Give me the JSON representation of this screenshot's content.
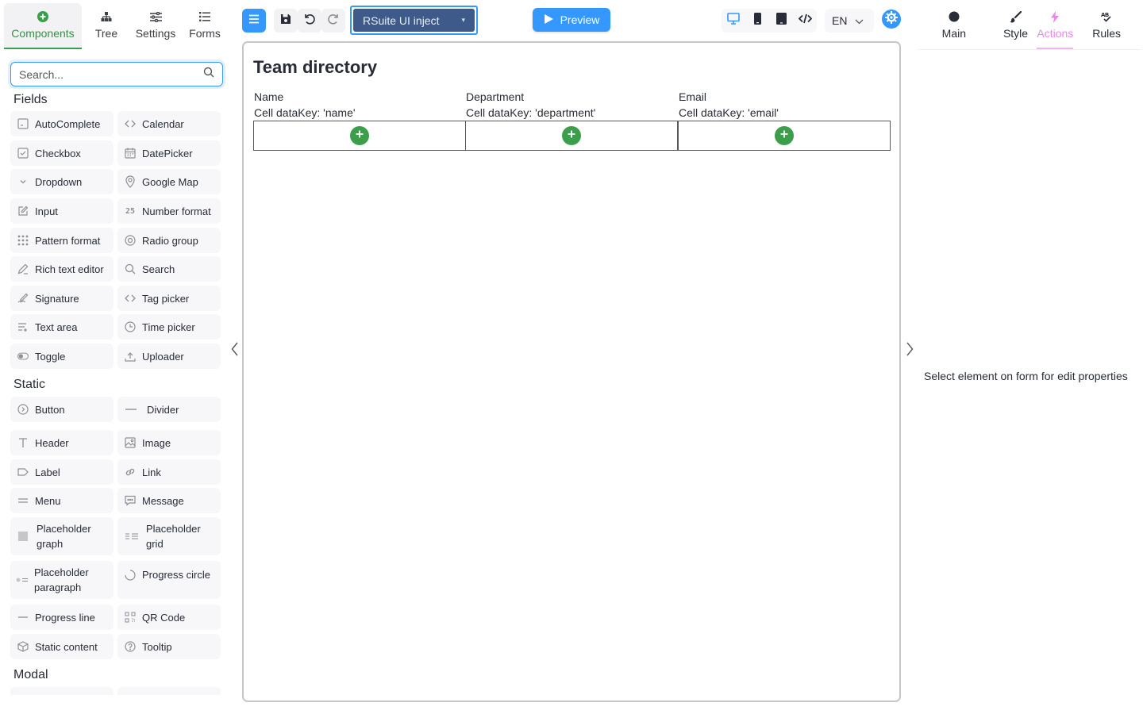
{
  "left_tabs": [
    {
      "label": "Components",
      "icon": "plus-circle-icon",
      "active": true
    },
    {
      "label": "Tree",
      "icon": "tree-icon"
    },
    {
      "label": "Settings",
      "icon": "sliders-icon"
    },
    {
      "label": "Forms",
      "icon": "list-icon"
    }
  ],
  "search": {
    "placeholder": "Search..."
  },
  "sections": {
    "fields": "Fields",
    "static": "Static",
    "modal": "Modal"
  },
  "fields": [
    {
      "label": "AutoComplete",
      "icon": "autocomplete-icon"
    },
    {
      "label": "Calendar",
      "icon": "code-brackets-icon"
    },
    {
      "label": "Checkbox",
      "icon": "checkbox-icon"
    },
    {
      "label": "DatePicker",
      "icon": "calendar-icon"
    },
    {
      "label": "Dropdown",
      "icon": "chevron-down-icon"
    },
    {
      "label": "Google Map",
      "icon": "map-pin-icon"
    },
    {
      "label": "Input",
      "icon": "edit-icon"
    },
    {
      "label": "Number format",
      "icon": "number-icon"
    },
    {
      "label": "Pattern format",
      "icon": "dots-grid-icon"
    },
    {
      "label": "Radio group",
      "icon": "radio-icon"
    },
    {
      "label": "Rich text editor",
      "icon": "pencil-icon"
    },
    {
      "label": "Search",
      "icon": "search-icon"
    },
    {
      "label": "Signature",
      "icon": "signature-icon"
    },
    {
      "label": "Tag picker",
      "icon": "code-brackets-icon"
    },
    {
      "label": "Text area",
      "icon": "text-lines-icon"
    },
    {
      "label": "Time picker",
      "icon": "clock-icon"
    },
    {
      "label": "Toggle",
      "icon": "toggle-icon"
    },
    {
      "label": "Uploader",
      "icon": "upload-icon"
    }
  ],
  "static": [
    {
      "label": "Button",
      "icon": "button-icon"
    },
    {
      "label": "Divider",
      "icon": "divider-icon"
    },
    {
      "label": "Header",
      "icon": "text-t-icon"
    },
    {
      "label": "Image",
      "icon": "image-icon"
    },
    {
      "label": "Label",
      "icon": "tag-icon"
    },
    {
      "label": "Link",
      "icon": "link-icon"
    },
    {
      "label": "Menu",
      "icon": "menu-lines-icon"
    },
    {
      "label": "Message",
      "icon": "message-icon"
    },
    {
      "label": "Placeholder graph",
      "icon": "square-icon"
    },
    {
      "label": "Placeholder grid",
      "icon": "grid-lines-icon"
    },
    {
      "label": "Placeholder paragraph",
      "icon": "paragraph-icon"
    },
    {
      "label": "Progress circle",
      "icon": "progress-circle-icon"
    },
    {
      "label": "Progress line",
      "icon": "progress-line-icon"
    },
    {
      "label": "QR Code",
      "icon": "qr-icon"
    },
    {
      "label": "Static content",
      "icon": "cube-icon"
    },
    {
      "label": "Tooltip",
      "icon": "help-circle-icon"
    }
  ],
  "toolbar": {
    "theme": "RSuite UI inject",
    "preview": "Preview",
    "language": "EN"
  },
  "form": {
    "title": "Team directory",
    "columns": [
      {
        "header": "Name",
        "cell": "Cell dataKey: 'name'"
      },
      {
        "header": "Department",
        "cell": "Cell dataKey: 'department'"
      },
      {
        "header": "Email",
        "cell": "Cell dataKey: 'email'"
      }
    ]
  },
  "right_tabs": [
    {
      "label": "Main",
      "icon": "circle-icon"
    },
    {
      "label": "Style",
      "icon": "brush-icon"
    },
    {
      "label": "Actions",
      "icon": "lightning-icon",
      "active": true
    },
    {
      "label": "Rules",
      "icon": "rules-icon"
    }
  ],
  "properties_hint": "Select element on form for edit properties",
  "colors": {
    "accent": "#3498ff",
    "green": "#3c9d4a",
    "actions_pink": "#e78be6",
    "theme_select_bg": "#3d5a8a"
  }
}
